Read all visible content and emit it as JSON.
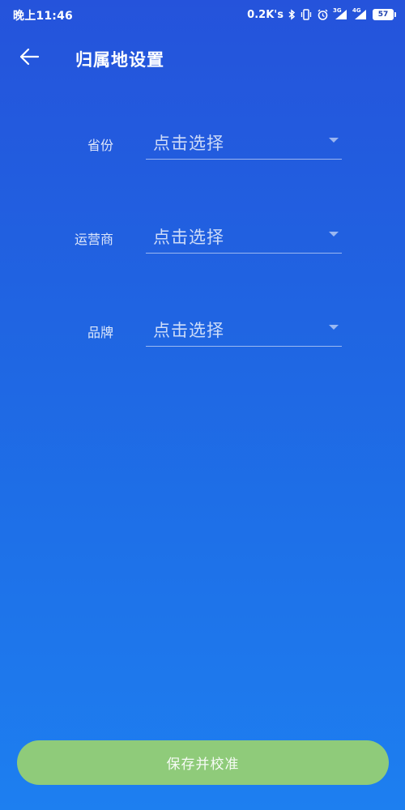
{
  "status_bar": {
    "time": "晚上11:46",
    "net_speed": "0.2K's",
    "signal_1_label": "3G",
    "signal_2_label": "4G",
    "battery": "57",
    "icons": [
      "bluetooth-icon",
      "vibrate-icon",
      "alarm-icon",
      "signal-icon",
      "signal-icon",
      "battery-icon"
    ]
  },
  "header": {
    "back_icon": "arrow-left-icon",
    "title": "归属地设置"
  },
  "form": {
    "fields": [
      {
        "label": "省份",
        "value": "点击选择"
      },
      {
        "label": "运营商",
        "value": "点击选择"
      },
      {
        "label": "品牌",
        "value": "点击选择"
      }
    ]
  },
  "footer": {
    "save_label": "保存并校准"
  },
  "colors": {
    "background_top": "#2553db",
    "background_bottom": "#1d7ff0",
    "button": "#8fcb7a",
    "text": "#ffffff"
  }
}
